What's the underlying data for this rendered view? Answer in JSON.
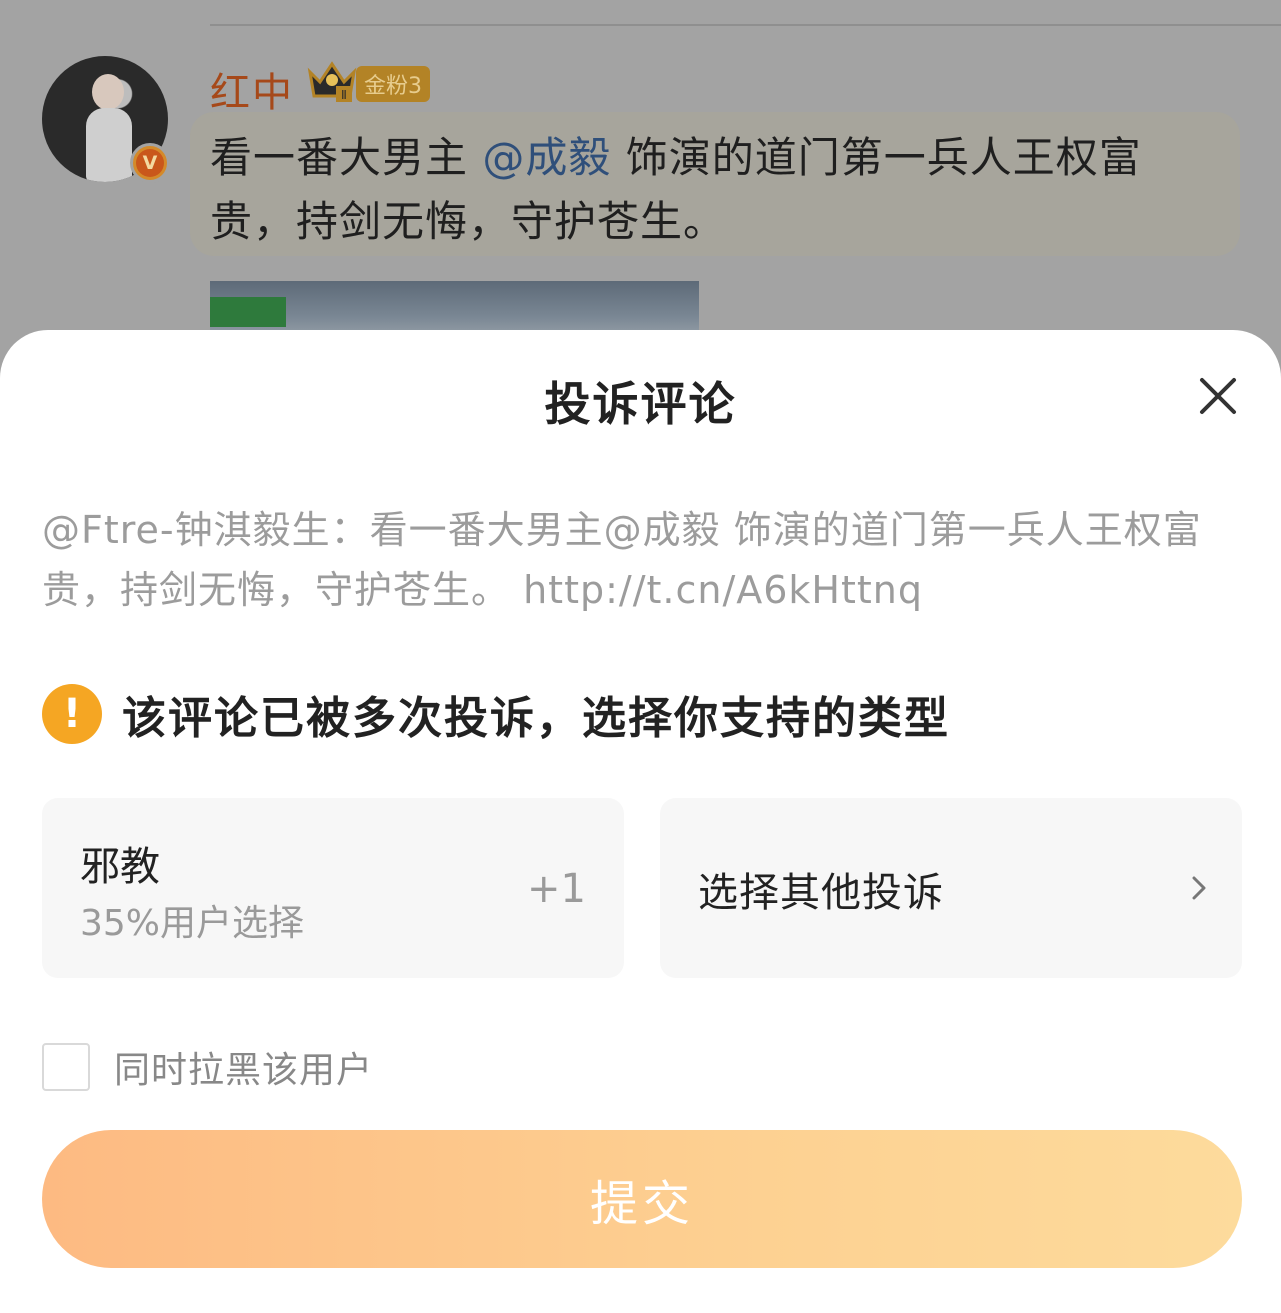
{
  "feed": {
    "username": "红中",
    "fan_badge": "金粉3",
    "verified_badge": "V",
    "crown_level": "Ⅱ",
    "post_text_before": "看一番大男主 ",
    "post_mention": "@成毅",
    "post_text_after": " 饰演的道门第一兵人王权富贵，持剑无悔，守护苍生。"
  },
  "sheet": {
    "title": "投诉评论",
    "quoted_comment": "@Ftre-钟淇毅生：看一番大男主@成毅 饰演的道门第一兵人王权富贵，持剑无悔，守护苍生。 http://t.cn/A6kHttnq",
    "warning_icon": "!",
    "warning_text": "该评论已被多次投诉，选择你支持的类型",
    "option": {
      "title": "邪教",
      "subtitle": "35%用户选择",
      "plus": "+1"
    },
    "other_option_label": "选择其他投诉",
    "block_user_label": "同时拉黑该用户",
    "submit_label": "提交"
  },
  "colors": {
    "accent_orange": "#f5a623",
    "submit_gradient_start": "#fdba82",
    "submit_gradient_end": "#fddb9c"
  }
}
